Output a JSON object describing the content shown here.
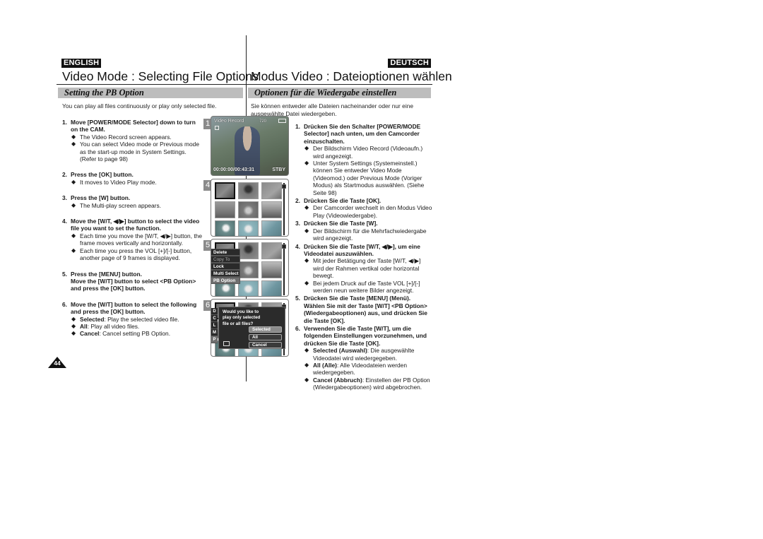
{
  "header": {
    "en": {
      "lang": "ENGLISH",
      "title": "Video Mode : Selecting File Options",
      "section": "Setting the PB Option",
      "intro": "You can play all files continuously or play only selected file."
    },
    "de": {
      "lang": "DEUTSCH",
      "title": "Modus Video : Dateioptionen wählen",
      "section": "Optionen für die Wiedergabe einstellen",
      "intro": "Sie können entweder alle Dateien nacheinander oder nur eine ausgewählte Datei wiedergeben."
    }
  },
  "steps_en": [
    {
      "num": "1.",
      "head": "Move [POWER/MODE Selector] down to turn on the CAM.",
      "bullets": [
        {
          "text": "The Video Record screen appears."
        },
        {
          "text": "You can select Video mode or Previous mode as the start-up mode in System Settings. (Refer to page 98)"
        }
      ]
    },
    {
      "num": "2.",
      "head": "Press the [OK] button.",
      "bullets": [
        {
          "text": "It moves to Video Play mode."
        }
      ]
    },
    {
      "num": "3.",
      "head": "Press the [W] button.",
      "bullets": [
        {
          "text": "The Multi-play screen appears."
        }
      ]
    },
    {
      "num": "4.",
      "head": "Move the [W/T, ◀/▶] button to select the video file you want to set the function.",
      "bullets": [
        {
          "text": "Each time you move the [W/T, ◀/▶] button, the frame moves vertically and horizontally."
        },
        {
          "text": "Each time you press the VOL [+]/[-] button, another page of 9 frames is displayed."
        }
      ]
    },
    {
      "num": "5.",
      "head": "Press the [MENU] button.",
      "sub": "Move the [W/T] button to select <PB Option> and press the [OK] button.",
      "bullets": []
    },
    {
      "num": "6.",
      "head": "Move the [W/T] button to select the following and press the [OK] button.",
      "bullets": [
        {
          "term": "Selected",
          "text": ": Play the selected video file."
        },
        {
          "term": "All",
          "text": ": Play all video files."
        },
        {
          "term": "Cancel",
          "text": ": Cancel setting PB Option."
        }
      ]
    }
  ],
  "steps_de": [
    {
      "num": "1.",
      "head": "Drücken Sie den Schalter [POWER/MODE Selector] nach unten, um den Camcorder einzuschalten.",
      "bullets": [
        {
          "text": "Der Bildschirm Video Record (Videoaufn.) wird angezeigt."
        },
        {
          "text": "Unter System Settings (Systemeinstell.) können Sie entweder Video Mode (Videomod.) oder Previous Mode (Voriger Modus) als Startmodus auswählen. (Siehe Seite  98)"
        }
      ]
    },
    {
      "num": "2.",
      "head": "Drücken Sie die Taste [OK].",
      "bullets": [
        {
          "text": "Der Camcorder wechselt in den Modus Video Play (Videowiedergabe)."
        }
      ]
    },
    {
      "num": "3.",
      "head": "Drücken Sie die Taste [W].",
      "bullets": [
        {
          "text": "Der Bildschirm für die Mehrfachwiedergabe wird angezeigt."
        }
      ]
    },
    {
      "num": "4.",
      "head": "Drücken Sie die Taste [W/T, ◀/▶], um eine Videodatei auszuwählen.",
      "bullets": [
        {
          "text": "Mit jeder Betätigung der Taste [W/T, ◀/▶] wird der Rahmen vertikal oder horizontal bewegt."
        },
        {
          "text": "Bei jedem Druck auf die Taste VOL [+]/[-] werden neun weitere Bilder angezeigt."
        }
      ]
    },
    {
      "num": "5.",
      "head": "Drücken Sie die Taste [MENU] (Menü).",
      "sub": "Wählen Sie mit der Taste [W/T] <PB Option> (Wiedergabeoptionen) aus, und drücken Sie die Taste [OK].",
      "bullets": []
    },
    {
      "num": "6.",
      "head": "Verwenden Sie die Taste [W/T], um die folgenden Einstellungen vorzunehmen, und drücken Sie die Taste [OK].",
      "bullets": [
        {
          "term": "Selected (Auswahl)",
          "text": ": Die ausgewählte Videodatei wird wiedergegeben."
        },
        {
          "term": "All (Alle)",
          "text": ": Alle Videodateien werden wiedergegeben."
        },
        {
          "term": "Cancel (Abbruch)",
          "text": ": Einstellen der PB Option (Wiedergabeoptionen) wird abgebrochen."
        }
      ]
    }
  ],
  "screens": {
    "s1": {
      "label": "1",
      "mode": "Video Record",
      "resolution": "720",
      "time": "00:00:00/00:43:31",
      "status": "STBY"
    },
    "s4": {
      "label": "4"
    },
    "s5": {
      "label": "5",
      "menu": [
        "Delete",
        "Copy To",
        "Lock",
        "Multi Select",
        "PB Option"
      ]
    },
    "s6": {
      "label": "6",
      "side": [
        "D",
        "C",
        "L",
        "M",
        "P"
      ],
      "question": "Would you like to play only selected file or all files?",
      "options": [
        "Selected",
        "All",
        "Cancel"
      ]
    }
  },
  "page_number": "44",
  "icons": {
    "bullet": "◆"
  }
}
